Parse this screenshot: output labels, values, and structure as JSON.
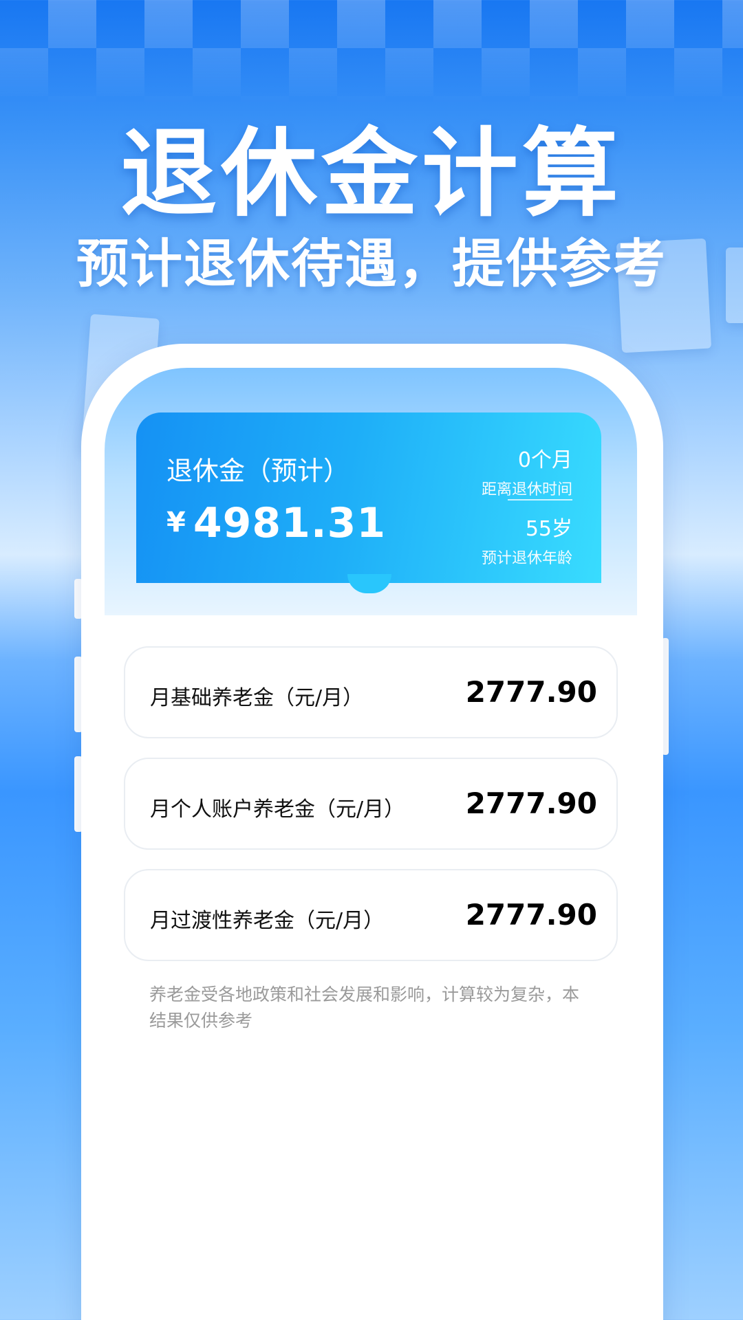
{
  "hero": {
    "title": "退休金计算",
    "subtitle": "预计退休待遇，提供参考"
  },
  "summary": {
    "label": "退休金（预计）",
    "currency": "¥",
    "amount": "4981.31",
    "months_to_retire": {
      "value": "0个月",
      "caption": "距离退休时间"
    },
    "retire_age": {
      "value": "55岁",
      "caption": "预计退休年龄"
    }
  },
  "items": [
    {
      "label": "月基础养老金（元/月）",
      "value": "2777.90"
    },
    {
      "label": "月个人账户养老金（元/月）",
      "value": "2777.90"
    },
    {
      "label": "月过渡性养老金（元/月）",
      "value": "2777.90"
    }
  ],
  "note": "养老金受各地政策和社会发展和影响，计算较为复杂，本结果仅供参考",
  "colors": {
    "primary": "#1591f4",
    "accent": "#39dcfe",
    "background_top": "#1877f2",
    "note_text": "#9a9a9a"
  }
}
